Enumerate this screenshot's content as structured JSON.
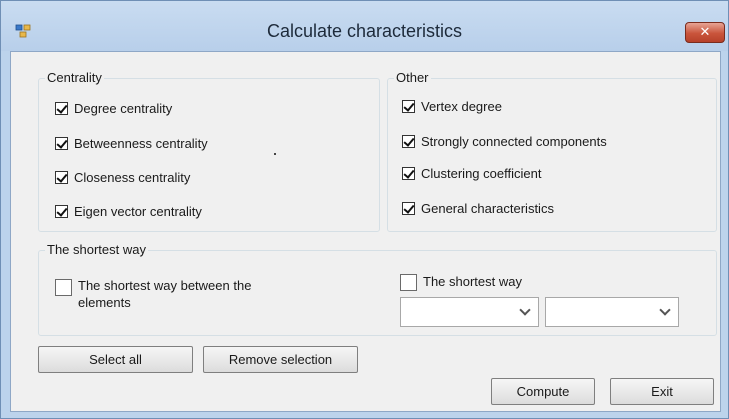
{
  "window": {
    "title": "Calculate characteristics",
    "close_glyph": "✕"
  },
  "centrality": {
    "label": "Centrality",
    "items": [
      {
        "label": "Degree centrality",
        "checked": true
      },
      {
        "label": "Betweenness centrality",
        "checked": true
      },
      {
        "label": "Closeness centrality",
        "checked": true
      },
      {
        "label": "Eigen vector centrality",
        "checked": true
      }
    ]
  },
  "other": {
    "label": "Other",
    "items": [
      {
        "label": "Vertex degree",
        "checked": true
      },
      {
        "label": "Strongly connected components",
        "checked": true
      },
      {
        "label": "Clustering coefficient",
        "checked": true
      },
      {
        "label": "General characteristics",
        "checked": true
      }
    ]
  },
  "shortest": {
    "label": "The shortest way",
    "between_label": "The shortest way between the elements",
    "between_checked": false,
    "way_label": "The shortest way",
    "way_checked": false,
    "combo1_value": "",
    "combo2_value": ""
  },
  "buttons": {
    "select_all": "Select all",
    "remove_selection": "Remove selection",
    "compute": "Compute",
    "exit": "Exit"
  }
}
